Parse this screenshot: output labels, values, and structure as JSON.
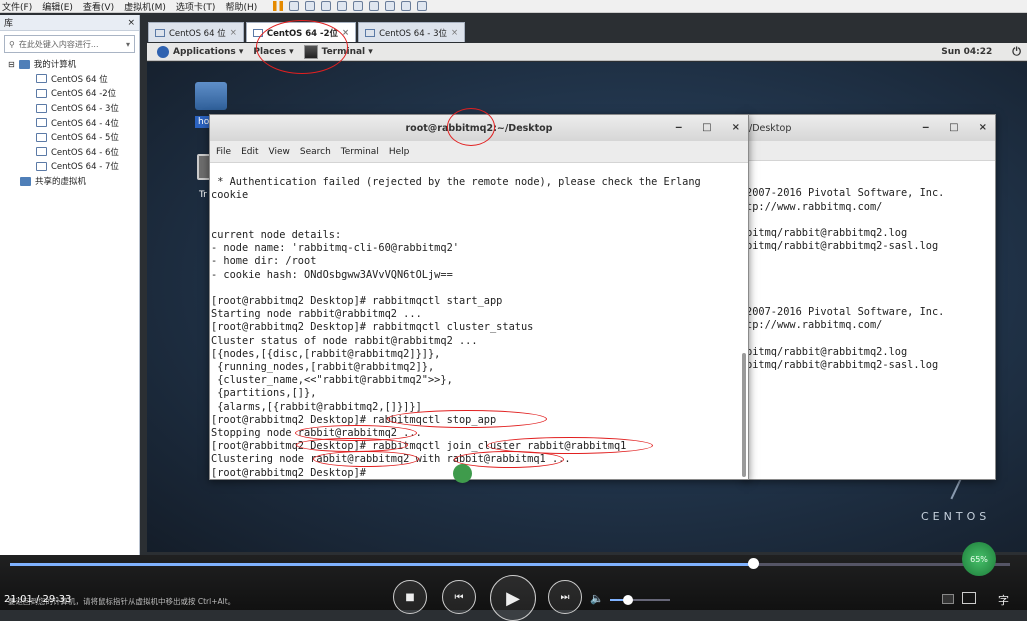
{
  "host_menu": {
    "items": [
      "文件(F)",
      "编辑(E)",
      "查看(V)",
      "虚拟机(M)",
      "选项卡(T)",
      "帮助(H)"
    ]
  },
  "library": {
    "title": "库",
    "close": "×",
    "search_placeholder": "在此处键入内容进行...",
    "root": "我的计算机",
    "vms": [
      "CentOS 64 位",
      "CentOS 64 -2位",
      "CentOS 64 - 3位",
      "CentOS 64 - 4位",
      "CentOS 64 - 5位",
      "CentOS 64 - 6位",
      "CentOS 64 - 7位"
    ],
    "shared": "共享的虚拟机"
  },
  "vm_tabs": [
    {
      "label": "CentOS 64 位",
      "active": false
    },
    {
      "label": "CentOS 64 -2位",
      "active": true
    },
    {
      "label": "CentOS 64 - 3位",
      "active": false
    }
  ],
  "gnome": {
    "applications": "Applications ▾",
    "places": "Places ▾",
    "terminal": "Terminal ▾",
    "clock": "Sun 04:22"
  },
  "desktop": {
    "home_label": "ho",
    "trash_label": "Tr",
    "brand": "CENTOS"
  },
  "front_terminal": {
    "title": "root@rabbitmq2:~/Desktop",
    "menu": [
      "File",
      "Edit",
      "View",
      "Search",
      "Terminal",
      "Help"
    ],
    "lines": [
      "",
      " * Authentication failed (rejected by the remote node), please check the Erlang",
      "cookie",
      "",
      "",
      "current node details:",
      "- node name: 'rabbitmq-cli-60@rabbitmq2'",
      "- home dir: /root",
      "- cookie hash: ONdOsbgww3AVvVQN6tOLjw==",
      "",
      "[root@rabbitmq2 Desktop]# rabbitmqctl start_app",
      "Starting node rabbit@rabbitmq2 ...",
      "[root@rabbitmq2 Desktop]# rabbitmqctl cluster_status",
      "Cluster status of node rabbit@rabbitmq2 ...",
      "[{nodes,[{disc,[rabbit@rabbitmq2]}]},",
      " {running_nodes,[rabbit@rabbitmq2]},",
      " {cluster_name,<<\"rabbit@rabbitmq2\">>},",
      " {partitions,[]},",
      " {alarms,[{rabbit@rabbitmq2,[]}]}]",
      "[root@rabbitmq2 Desktop]# rabbitmqctl stop_app",
      "Stopping node rabbit@rabbitmq2 ...",
      "[root@rabbitmq2 Desktop]# rabbitmqctl join_cluster rabbit@rabbitmq1",
      "Clustering node rabbit@rabbitmq2 with rabbit@rabbitmq1 ...",
      "[root@rabbitmq2 Desktop]#"
    ]
  },
  "back_terminal": {
    "title": "/Desktop",
    "lines": [
      "",
      "",
      "2007-2016 Pivotal Software, Inc.",
      "tp://www.rabbitmq.com/",
      "",
      "bitmq/rabbit@rabbitmq2.log",
      "bitmq/rabbit@rabbitmq2-sasl.log",
      "",
      "",
      "",
      "",
      "2007-2016 Pivotal Software, Inc.",
      "tp://www.rabbitmq.com/",
      "",
      "bitmq/rabbit@rabbitmq2.log",
      "bitmq/rabbit@rabbitmq2-sasl.log"
    ]
  },
  "player": {
    "time": "21:01 / 29:33",
    "progress": 0.743,
    "status": "要返回到您的计算机，请将鼠标指针从虚拟机中移出或按 Ctrl+Alt。",
    "speed": "65%",
    "ime": "字"
  },
  "colors": {
    "annotation": "#e12020",
    "accent": "#7fb2ff"
  }
}
